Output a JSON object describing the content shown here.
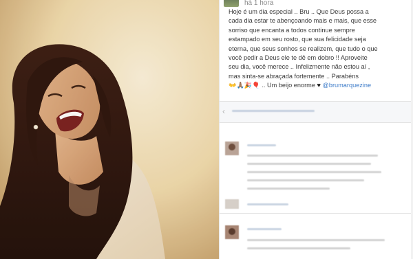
{
  "post": {
    "time": "há 1 hora",
    "caption_lines": [
      "Hoje é um dia especial .. Bru .. Que Deus possa a",
      "cada dia estar te abençoando mais e mais, que esse",
      "sorriso que encanta a todos continue sempre",
      "estampado em seu rosto, que sua felicidade seja",
      "eterna, que seus sonhos se realizem, que tudo o que",
      "você pedir a Deus ele te dê em dobro !! Aproveite",
      "seu dia, você merece .. Infelizmente não estou aí ,",
      "mas sinta-se abraçada fortemente .. Parabéns"
    ],
    "closing_emoji": "👐🙏🏽🎉🎈",
    "closing_text": " .. Um beijo enorme ",
    "heart": "♥",
    "mention": "@brumarquezine"
  },
  "colors": {
    "mention": "#3d7cc9",
    "photo_tone": "#f3dfb4"
  },
  "icons": {
    "chevron": "chevron-left-icon"
  }
}
